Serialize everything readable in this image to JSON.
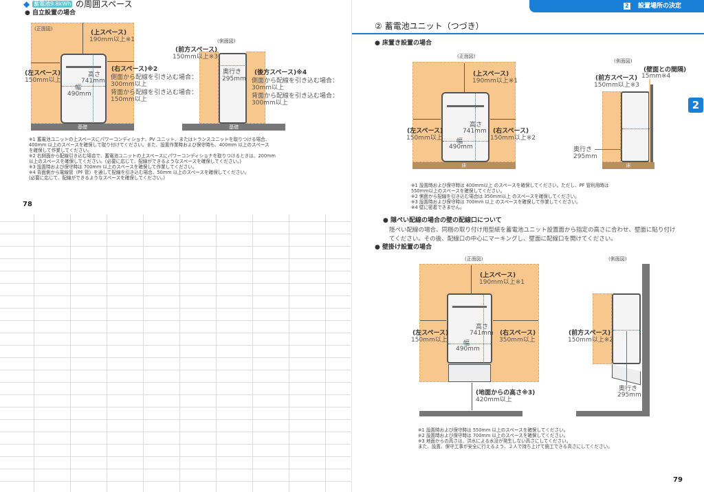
{
  "left_page": {
    "title_badge": "蓄電池9.8kWh",
    "title": "の周囲スペース",
    "subtitle": "● 自立設置の場合",
    "front": {
      "view": "(正面図)",
      "top_label": "(上スペース)",
      "top_value": "190mm以上※1",
      "left_label": "(左スペース)",
      "left_value": "150mm以上",
      "right_label": "(右スペース)※2",
      "right_l1": "側面から配線を引き込む場合：",
      "right_v1": "300mm以上",
      "right_l2": "背面から配線を引き込む場合：",
      "right_v2": "150mm以上",
      "height_label": "高さ",
      "height_value": "741mm",
      "width_label": "幅",
      "width_value": "490mm",
      "base": "基礎"
    },
    "side": {
      "view": "(側面図)",
      "front_label": "(前方スペース)",
      "front_value": "150mm以上※3",
      "depth_label": "奥行き",
      "depth_value": "295mm",
      "back_label": "(後方スペース)※4",
      "back_l1": "側面から配線を引き込む場合：",
      "back_v1": "30mm以上",
      "back_l2": "背面から配線を引き込む場合：",
      "back_v2": "300mm以上",
      "base": "基礎"
    },
    "notes": [
      "※1  蓄電池ユニットの上スペースにパワーコンディショナ、PV ユニット、またはトランスユニットを取りつける場合、",
      "       400mm 以上のスペースを確保して取り付けてください。また、設置作業時および保守時も、400mm 以上のスペース",
      "       を確保して作業してください。",
      "※2  右側面から配線引き込む場合で、蓄電池ユニットの上スペースにパワーコンディショナを取りつけるときは、200mm",
      "       以上のスペースを確保してください。(必要に応じて、配線ができるようなスペースを確保してください。)",
      "※3  設置時および保守時は 700mm 以上のスペースを確保して作業してください。",
      "※4  背面側から電線管（PF 管）を通して配線を引き込む場合、50mm 以上のスペースを確保してください。",
      "       (必要に応じて、配線ができるようなスペースを確保してください。)"
    ],
    "page_number": "78"
  },
  "right_page": {
    "header_num": "2",
    "header_title": "設置場所の決定",
    "side_tab": "2",
    "section_title": "② 蓄電池ユニット（つづき）",
    "floor": {
      "heading": "● 床置き設置の場合",
      "front_view": "(正面図)",
      "top_label": "(上スペース)",
      "top_value": "190mm以上※1",
      "left_label": "(左スペース)",
      "left_value": "150mm以上",
      "right_label": "(右スペース)",
      "right_value": "150mm以上※2",
      "height_label": "高さ",
      "height_value": "741mm",
      "width_label": "幅",
      "width_value": "490mm",
      "floor": "床",
      "side_view": "(側面図)",
      "wall_label": "(壁面との間隔)",
      "wall_value": "15mm※4",
      "front_label": "(前方スペース)",
      "front_value": "150mm以上※3",
      "depth_label": "奥行き",
      "depth_value": "295mm",
      "side_floor": "床"
    },
    "floor_notes": [
      "※1 設置時および保守時は 400mm以上 のスペースを確保してください。ただし、PF 管利用時は",
      "       550mm以上のスペースを確保してください。",
      "※2  側面から配線を引き込む場合は 350mm以上 のスペースを確保してください。",
      "※3  設置時および保守時は 700mm 以上 のスペースを確保して作業してください。",
      "※4  壁に密着できません。"
    ],
    "hidden_heading": "● 隠ぺい配線の場合の壁の配線口について",
    "hidden_text": [
      "隠ぺい配線の場合、同梱の取り付け用型紙を蓄電池ユニット設置面から指定の高さに合わせ、壁面に貼り付け",
      "てください。その後、配線口の中心にマーキングし、壁面に配線口を開けてください。"
    ],
    "wall": {
      "heading": "● 壁掛け設置の場合",
      "front_view": "(正面図)",
      "top_label": "(上スペース)",
      "top_value": "190mm以上※1",
      "left_label": "(左スペース)",
      "left_value": "150mm以上",
      "right_label": "(右スペース)",
      "right_value": "350mm以上",
      "height_label": "高さ",
      "height_value": "741mm",
      "width_label": "幅",
      "width_value": "490mm",
      "ground_label": "(地面からの高さ※3)",
      "ground_value": "420mm以上",
      "side_view": "(側面図)",
      "front_label": "(前方スペース)",
      "front_value": "150mm以上※2",
      "depth_label": "奥行き",
      "depth_value": "295mm"
    },
    "wall_notes": [
      "※1  設置時および保守時は 550mm 以上のスペースを確保してください。",
      "※2  設置時および保守時は 700mm 以上のスペースを確保してください。",
      "※3  地面からの高さは、洪水による水没が発生しない高さにしてください。",
      "       また、設置、保守工事が安全に行えるよう、２人で持ち上げて施工できる高さにしてください。"
    ],
    "page_number": "79"
  },
  "colors": {
    "accent": "#1a7fd6",
    "space": "#f8c78d",
    "badge": "#5ec3d0"
  }
}
